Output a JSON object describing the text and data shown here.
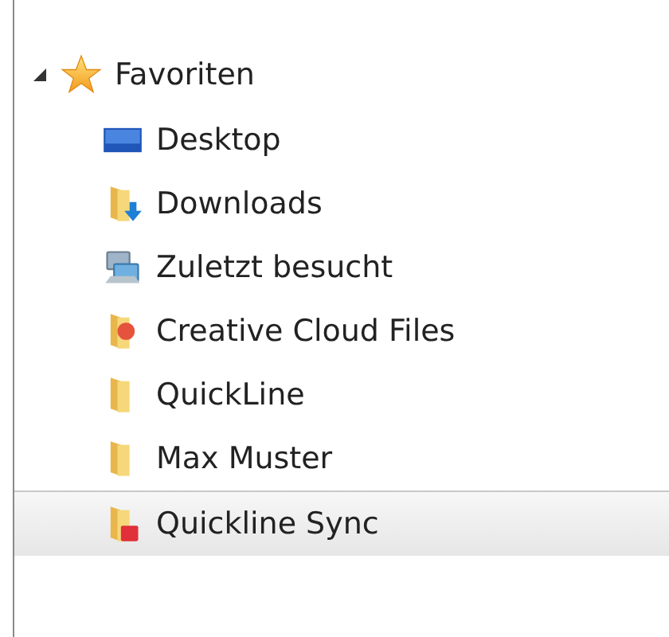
{
  "tree": {
    "label": "Favoriten",
    "expanded": true,
    "selected": false,
    "children": [
      {
        "label": "Desktop",
        "kind": "desktop",
        "selected": false
      },
      {
        "label": "Downloads",
        "kind": "downloads",
        "selected": false
      },
      {
        "label": "Zuletzt besucht",
        "kind": "recent",
        "selected": false
      },
      {
        "label": "Creative Cloud Files",
        "kind": "cloud-files",
        "selected": false
      },
      {
        "label": "QuickLine",
        "kind": "folder",
        "selected": false
      },
      {
        "label": "Max Muster",
        "kind": "folder",
        "selected": false
      },
      {
        "label": "Quickline Sync",
        "kind": "sync",
        "selected": true
      }
    ]
  }
}
